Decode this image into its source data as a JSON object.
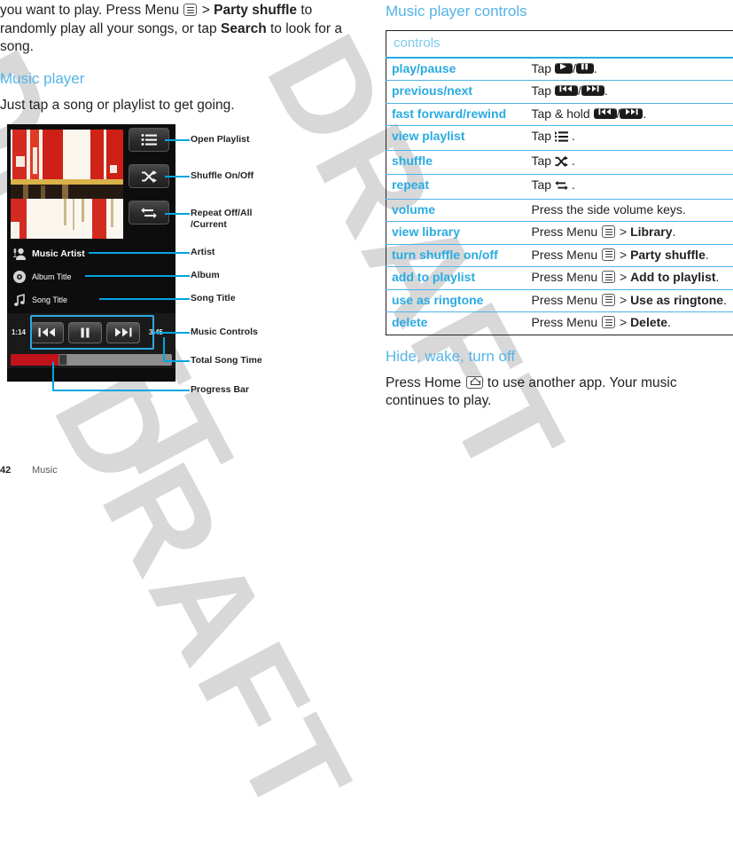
{
  "watermark": {
    "text": "DRAFT"
  },
  "left_column": {
    "intro_paragraph": {
      "part1": "you want to play. Press Menu ",
      "icon": "menu-key-icon",
      "part2": " > ",
      "bold1": "Party shuffle",
      "part3": " to randomly play all your songs, or tap ",
      "bold2": "Search",
      "part4": " to look for a song."
    },
    "section_heading": "Music player",
    "section_paragraph": "Just tap a song or playlist to get going."
  },
  "phone": {
    "album_art_label": "album-artwork",
    "side_buttons": [
      {
        "name": "open-playlist-button",
        "icon": "playlist-icon"
      },
      {
        "name": "shuffle-button",
        "icon": "shuffle-icon"
      },
      {
        "name": "repeat-button",
        "icon": "repeat-icon"
      }
    ],
    "meta": [
      {
        "icon": "artist-icon",
        "text": "Music Artist"
      },
      {
        "icon": "album-icon",
        "text": "Album Title"
      },
      {
        "icon": "song-icon",
        "text": "Song Title"
      }
    ],
    "elapsed_time": "1:14",
    "total_time": "3:45",
    "transport": [
      {
        "name": "previous-button",
        "icon": "previous-icon"
      },
      {
        "name": "pause-button",
        "icon": "pause-icon"
      },
      {
        "name": "next-button",
        "icon": "next-icon"
      }
    ],
    "progress_percent": 31
  },
  "callouts": [
    {
      "label": "Open Playlist"
    },
    {
      "label": "Shuffle On/Off"
    },
    {
      "label_line1": "Repeat Off/All",
      "label_line2": "/Current"
    },
    {
      "label": "Artist"
    },
    {
      "label": "Album"
    },
    {
      "label": "Song Title"
    },
    {
      "label": "Music Controls"
    },
    {
      "label": "Total Song Time"
    },
    {
      "label": "Progress Bar"
    }
  ],
  "right_column": {
    "section_heading": "Music player controls",
    "table": {
      "header": "controls",
      "rows": [
        {
          "key": "play/pause",
          "value_pre": "Tap ",
          "icons": [
            "play-icon",
            "pause-icon"
          ],
          "value_post": "."
        },
        {
          "key": "previous/next",
          "value_pre": "Tap ",
          "icons": [
            "previous-icon",
            "next-icon"
          ],
          "value_post": "."
        },
        {
          "key": "fast forward/rewind",
          "value_pre": "Tap & hold ",
          "icons": [
            "previous-icon",
            "next-icon"
          ],
          "value_post": "."
        },
        {
          "key": "view playlist",
          "value_pre": "Tap ",
          "icons": [
            "playlist-icon"
          ],
          "value_post": " ."
        },
        {
          "key": "shuffle",
          "value_pre": "Tap ",
          "icons": [
            "shuffle-icon"
          ],
          "value_post": " ."
        },
        {
          "key": "repeat",
          "value_pre": "Tap ",
          "icons": [
            "repeat-icon"
          ],
          "value_post": " ."
        },
        {
          "key": "volume",
          "value_plain": "Press the side volume keys."
        },
        {
          "key": "view library",
          "value_pre": "Press Menu ",
          "menu_icon": true,
          "value_mid": " > ",
          "value_bold": "Library",
          "value_post": "."
        },
        {
          "key": "turn shuffle on/off",
          "value_pre": "Press Menu ",
          "menu_icon": true,
          "value_mid": " > ",
          "value_bold": "Party shuffle",
          "value_post": "."
        },
        {
          "key": "add to playlist",
          "value_pre": "Press Menu ",
          "menu_icon": true,
          "value_mid": " > ",
          "value_bold": "Add to playlist",
          "value_post": "."
        },
        {
          "key": "use as ringtone",
          "value_pre": "Press Menu ",
          "menu_icon": true,
          "value_mid": " > ",
          "value_bold": "Use as ringtone",
          "value_post": "."
        },
        {
          "key": "delete",
          "value_pre": "Press Menu ",
          "menu_icon": true,
          "value_mid": " > ",
          "value_bold": "Delete",
          "value_post": "."
        }
      ]
    },
    "section_heading_2": "Hide, wake, turn off",
    "paragraph_2": {
      "part1": "Press Home ",
      "icon": "home-key-icon",
      "part2": " to use another app. Your music continues to play."
    }
  },
  "footer": {
    "page_number": "42",
    "chapter": "Music"
  },
  "colors": {
    "accent_blue": "#29abe2",
    "heading_blue": "#55b4e8",
    "table_rule": "#4eb3e8",
    "progress_red": "#c1121c",
    "text": "#231f20",
    "watermark_gray": "#d8d8d8"
  }
}
